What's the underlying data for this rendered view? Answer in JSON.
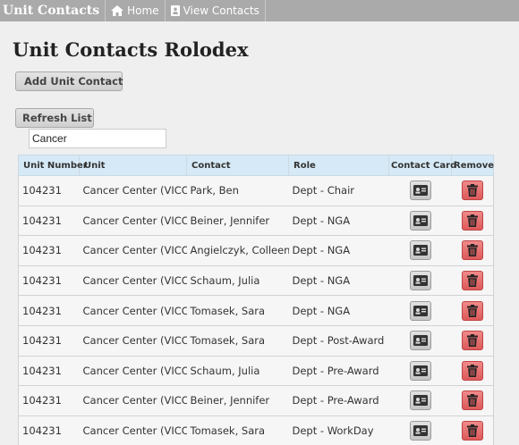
{
  "navbar": {
    "brand": "Unit Contacts",
    "home_label": "Home",
    "view_contacts_label": "View Contacts"
  },
  "page": {
    "title": "Unit Contacts Rolodex",
    "add_button": "Add Unit Contact",
    "refresh_button": "Refresh List"
  },
  "search": {
    "value": "Cancer"
  },
  "table": {
    "headers": [
      "Unit Number",
      "Unit",
      "Contact",
      "Role",
      "Contact Card",
      "Remove"
    ],
    "rows": [
      {
        "unit_number": "104231",
        "unit": "Cancer Center (VICC)",
        "contact": "Park, Ben",
        "role": "Dept - Chair"
      },
      {
        "unit_number": "104231",
        "unit": "Cancer Center (VICC)",
        "contact": "Beiner, Jennifer",
        "role": "Dept - NGA"
      },
      {
        "unit_number": "104231",
        "unit": "Cancer Center (VICC)",
        "contact": "Angielczyk, Colleen",
        "role": "Dept - NGA"
      },
      {
        "unit_number": "104231",
        "unit": "Cancer Center (VICC)",
        "contact": "Schaum, Julia",
        "role": "Dept - NGA"
      },
      {
        "unit_number": "104231",
        "unit": "Cancer Center (VICC)",
        "contact": "Tomasek, Sara",
        "role": "Dept - NGA"
      },
      {
        "unit_number": "104231",
        "unit": "Cancer Center (VICC)",
        "contact": "Tomasek, Sara",
        "role": "Dept - Post-Award"
      },
      {
        "unit_number": "104231",
        "unit": "Cancer Center (VICC)",
        "contact": "Schaum, Julia",
        "role": "Dept - Pre-Award"
      },
      {
        "unit_number": "104231",
        "unit": "Cancer Center (VICC)",
        "contact": "Beiner, Jennifer",
        "role": "Dept - Pre-Award"
      },
      {
        "unit_number": "104231",
        "unit": "Cancer Center (VICC)",
        "contact": "Tomasek, Sara",
        "role": "Dept - WorkDay"
      }
    ]
  },
  "icons": {
    "home": "home-icon",
    "contacts": "contact-book-icon",
    "add": "plus-circle-icon",
    "refresh": "refresh-icon",
    "contact_card": "id-card-icon",
    "remove": "trash-icon"
  },
  "colors": {
    "navbar": "#aaaaaa",
    "table_header": "#d5e9f6",
    "remove_button": "#e06666"
  }
}
